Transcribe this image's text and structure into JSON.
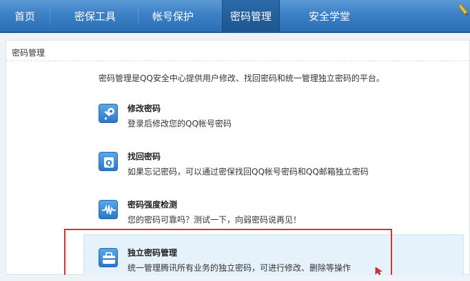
{
  "nav": {
    "items": [
      {
        "label": "首页",
        "active": false
      },
      {
        "label": "密保工具",
        "active": false
      },
      {
        "label": "帐号保护",
        "active": false
      },
      {
        "label": "密码管理",
        "active": true
      },
      {
        "label": "安全学堂",
        "active": false
      }
    ]
  },
  "panel": {
    "title": "密码管理",
    "intro": "密码管理是QQ安全中心提供用户修改、找回密码和统一管理独立密码的平台。"
  },
  "items": [
    {
      "icon": "key-icon",
      "title": "修改密码",
      "desc": "登录后修改您的QQ帐号密码"
    },
    {
      "icon": "find-password-icon",
      "title": "找回密码",
      "desc": "如果忘记密码，可以通过密保找回QQ帐号密码和QQ邮箱独立密码"
    },
    {
      "icon": "strength-wave-icon",
      "title": "密码强度检测",
      "desc": "您的密码可靠吗？测试一下，向弱密码说再见！"
    },
    {
      "icon": "briefcase-icon",
      "title": "独立密码管理",
      "desc": "统一管理腾讯所有业务的独立密码，可进行修改、删除等操作"
    }
  ],
  "colors": {
    "nav": "#3c80c5",
    "highlight": "#e5f2fc",
    "annotation": "#d9302b"
  }
}
